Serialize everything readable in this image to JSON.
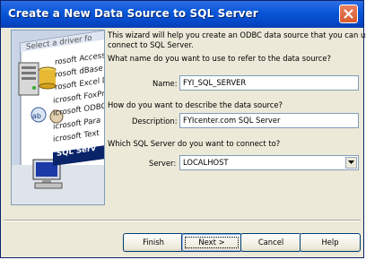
{
  "window": {
    "title": "Create a New Data Source to SQL Server"
  },
  "art": {
    "header": "Select a driver fo",
    "drivers": [
      "rosoft Access D",
      "rosoft dBase D",
      "rosoft Excel D",
      "icrosoft FoxPr",
      "icrosoft ODBC",
      "icrosoft Para",
      "icrosoft Text",
      "SQL Serv"
    ]
  },
  "form": {
    "intro": [
      "This wizard will help you create an ODBC data source that you can use to",
      "connect to SQL Server."
    ],
    "q_name": "What name do you want to use to refer to the data source?",
    "name_label": "Name:",
    "name_value": "FYI_SQL_SERVER",
    "q_desc": "How do you want to describe the data source?",
    "desc_label": "Description:",
    "desc_value": "FYIcenter.com SQL Server",
    "q_server": "Which SQL Server do you want to connect to?",
    "server_label": "Server:",
    "server_value": "LOCALHOST"
  },
  "buttons": {
    "finish": "Finish",
    "next": "Next >",
    "cancel": "Cancel",
    "help": "Help"
  }
}
